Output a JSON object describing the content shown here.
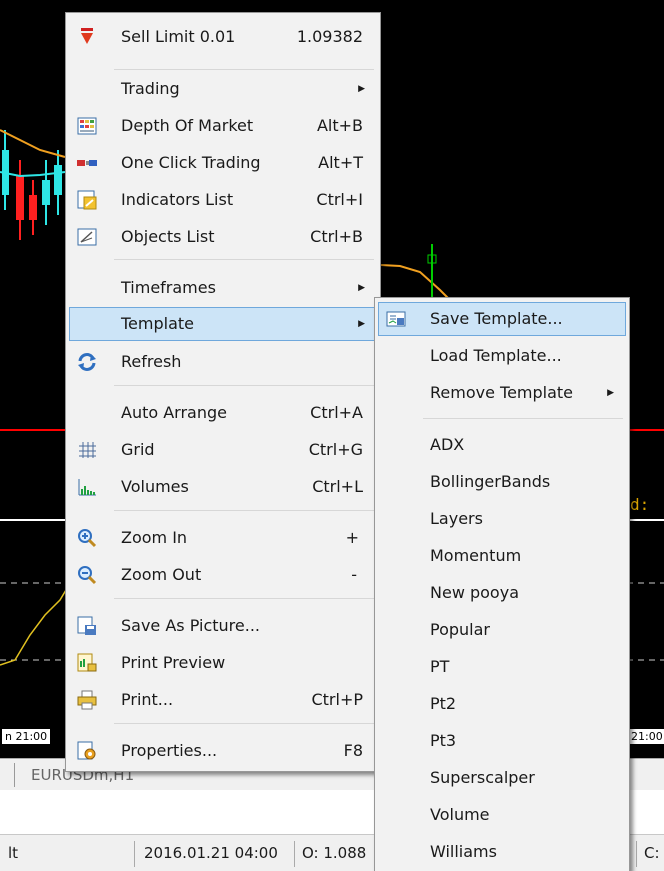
{
  "chart": {
    "time_left": "n 21:00",
    "time_right": "21:00",
    "indicator_tag": "d:"
  },
  "tabbar": {
    "symbol_tab": "EURUSDm,H1"
  },
  "statusbar": {
    "left": "lt",
    "datetime": "2016.01.21 04:00",
    "open": "O: 1.088",
    "right": "C:"
  },
  "context_menu": {
    "items": [
      {
        "label": "Sell Limit 0.01",
        "shortcut": "1.09382",
        "icon": "sell-arrow-icon"
      },
      {
        "label": "Trading",
        "submenu": true
      },
      {
        "label": "Depth Of Market",
        "shortcut": "Alt+B",
        "icon": "depth-of-market-icon"
      },
      {
        "label": "One Click Trading",
        "shortcut": "Alt+T",
        "icon": "one-click-trading-icon"
      },
      {
        "label": "Indicators List",
        "shortcut": "Ctrl+I",
        "icon": "indicators-list-icon"
      },
      {
        "label": "Objects List",
        "shortcut": "Ctrl+B",
        "icon": "objects-list-icon"
      },
      {
        "label": "Timeframes",
        "submenu": true
      },
      {
        "label": "Template",
        "submenu": true
      },
      {
        "label": "Refresh",
        "icon": "refresh-icon"
      },
      {
        "label": "Auto Arrange",
        "shortcut": "Ctrl+A"
      },
      {
        "label": "Grid",
        "shortcut": "Ctrl+G",
        "icon": "grid-icon"
      },
      {
        "label": "Volumes",
        "shortcut": "Ctrl+L",
        "icon": "volumes-icon"
      },
      {
        "label": "Zoom In",
        "shortcut": "+",
        "icon": "zoom-in-icon"
      },
      {
        "label": "Zoom Out",
        "shortcut": "-",
        "icon": "zoom-out-icon"
      },
      {
        "label": "Save As Picture...",
        "icon": "save-picture-icon"
      },
      {
        "label": "Print Preview",
        "icon": "print-preview-icon"
      },
      {
        "label": "Print...",
        "shortcut": "Ctrl+P",
        "icon": "print-icon"
      },
      {
        "label": "Properties...",
        "shortcut": "F8",
        "icon": "properties-icon"
      }
    ]
  },
  "template_submenu": {
    "items": [
      {
        "label": "Save Template...",
        "icon": "save-template-icon"
      },
      {
        "label": "Load Template..."
      },
      {
        "label": "Remove Template",
        "submenu": true
      },
      {
        "label": "ADX"
      },
      {
        "label": "BollingerBands"
      },
      {
        "label": "Layers"
      },
      {
        "label": "Momentum"
      },
      {
        "label": "New pooya"
      },
      {
        "label": "Popular"
      },
      {
        "label": "PT"
      },
      {
        "label": "Pt2"
      },
      {
        "label": "Pt3"
      },
      {
        "label": "Superscalper"
      },
      {
        "label": "Volume"
      },
      {
        "label": "Williams"
      }
    ]
  },
  "colors": {
    "highlight": "#cce4f7",
    "highlight_border": "#6fa8dc",
    "menu_bg": "#f2f2f2",
    "price_line": "#ff0000",
    "ma_line": "#f0a020"
  }
}
